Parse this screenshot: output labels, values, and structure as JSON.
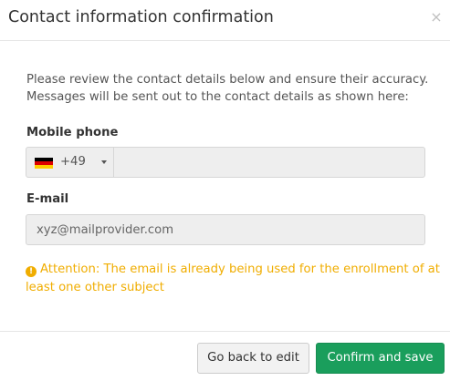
{
  "header": {
    "title": "Contact information confirmation",
    "close_icon": "×"
  },
  "intro": {
    "line1": "Please review the contact details below and ensure their accuracy.",
    "line2": "Messages will be sent out to the contact details as shown here:"
  },
  "phone": {
    "label": "Mobile phone",
    "country_flag": "germany-flag-icon",
    "dial_code": "+49",
    "value": ""
  },
  "email": {
    "label": "E-mail",
    "value": "xyz@mailprovider.com"
  },
  "warning": {
    "icon": "!",
    "line1": "Attention: The email is already being used for the enrollment of at",
    "line2": "least one other subject"
  },
  "footer": {
    "back_label": "Go back to edit",
    "confirm_label": "Confirm and save"
  },
  "colors": {
    "warning": "#f0ad00",
    "confirm": "#1a9e5c"
  }
}
